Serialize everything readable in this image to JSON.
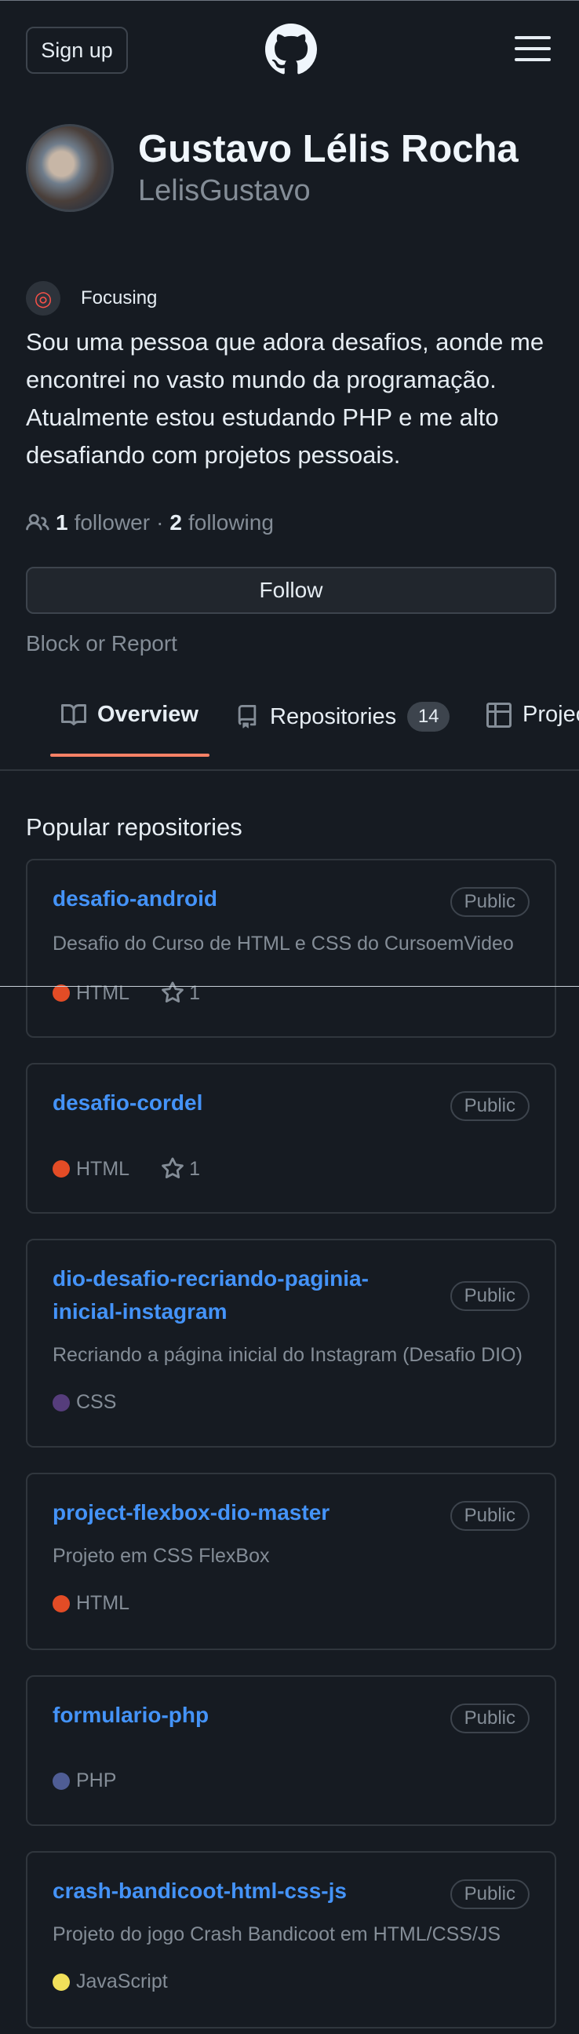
{
  "header": {
    "signup_label": "Sign up",
    "logo_icon": "github-mark-icon",
    "menu_icon": "hamburger-menu-icon"
  },
  "profile": {
    "name": "Gustavo Lélis Rocha",
    "login": "LelisGustavo",
    "status_emoji": "dart-icon",
    "status_text": "Focusing",
    "bio": "Sou uma pessoa que adora desafios, aonde me encontrei no vasto mundo da programação. Atualmente estou estudando PHP e me alto desafiando com projetos pessoais.",
    "followers_count": "1",
    "followers_label": "follower",
    "separator": "·",
    "following_count": "2",
    "following_label": "following",
    "follow_button": "Follow",
    "block_report": "Block or Report"
  },
  "tabs": [
    {
      "label": "Overview",
      "icon": "book-icon",
      "active": true
    },
    {
      "label": "Repositories",
      "icon": "repo-icon",
      "count": "14"
    },
    {
      "label": "Projects",
      "icon": "project-table-icon"
    }
  ],
  "popular": {
    "title": "Popular repositories",
    "repos": [
      {
        "name": "desafio-android",
        "visibility": "Public",
        "description": "Desafio do Curso de HTML e CSS do CursoemVideo",
        "language": "HTML",
        "lang_color": "#e34c26",
        "stars": "1"
      },
      {
        "name": "desafio-cordel",
        "visibility": "Public",
        "description": "",
        "language": "HTML",
        "lang_color": "#e34c26",
        "stars": "1"
      },
      {
        "name": "dio-desafio-recriando-paginia-inicial-instagram",
        "visibility": "Public",
        "description": "Recriando a página inicial do Instagram (Desafio DIO)",
        "language": "CSS",
        "lang_color": "#563d7c",
        "stars": ""
      },
      {
        "name": "project-flexbox-dio-master",
        "visibility": "Public",
        "description": "Projeto em CSS FlexBox",
        "language": "HTML",
        "lang_color": "#e34c26",
        "stars": ""
      },
      {
        "name": "formulario-php",
        "visibility": "Public",
        "description": "",
        "language": "PHP",
        "lang_color": "#4F5D95",
        "stars": ""
      },
      {
        "name": "crash-bandicoot-html-css-js",
        "visibility": "Public",
        "description": "Projeto do jogo Crash Bandicoot em HTML/CSS/JS",
        "language": "JavaScript",
        "lang_color": "#f1e05a",
        "stars": ""
      }
    ]
  }
}
